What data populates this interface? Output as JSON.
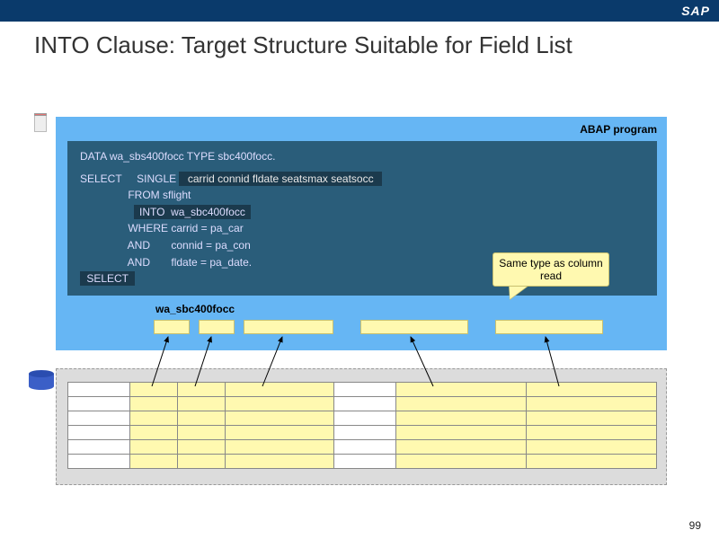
{
  "brand": "SAP",
  "title": "INTO Clause: Target Structure Suitable for Field List",
  "abap_label": "ABAP program",
  "code": {
    "l1": "DATA wa_sbs400focc TYPE sbc400focc.",
    "l2a": "SELECT     SINGLE ",
    "l2b": " carrid connid fldate seatsmax seatsocc ",
    "l3": "                FROM sflight",
    "l4a": "                  ",
    "l4b": "INTO  wa_sbc400focc",
    "l5": "                WHERE carrid = pa_car",
    "l6": "                AND       connid = pa_con",
    "l7": "                AND       fldate = pa_date.",
    "l8": " SELECT "
  },
  "wa_label": "wa_sbc400focc",
  "bubble": "Same type as column read",
  "page_number": "99",
  "chart_data": {
    "type": "table",
    "description": "Database table 'sflight' with 6 rows shown; columns 2,3,4 and 6,7 highlighted (yellow) correspond to selected fields carrid, connid, fldate, seatsmax, seatsocc mapping into work area wa_sbc400focc.",
    "columns_highlighted": [
      2,
      3,
      4,
      6,
      7
    ],
    "columns_plain": [
      1,
      5
    ],
    "rows": 6,
    "selected_fields": [
      "carrid",
      "connid",
      "fldate",
      "seatsmax",
      "seatsocc"
    ],
    "from_table": "sflight",
    "into_target": "wa_sbc400focc"
  }
}
